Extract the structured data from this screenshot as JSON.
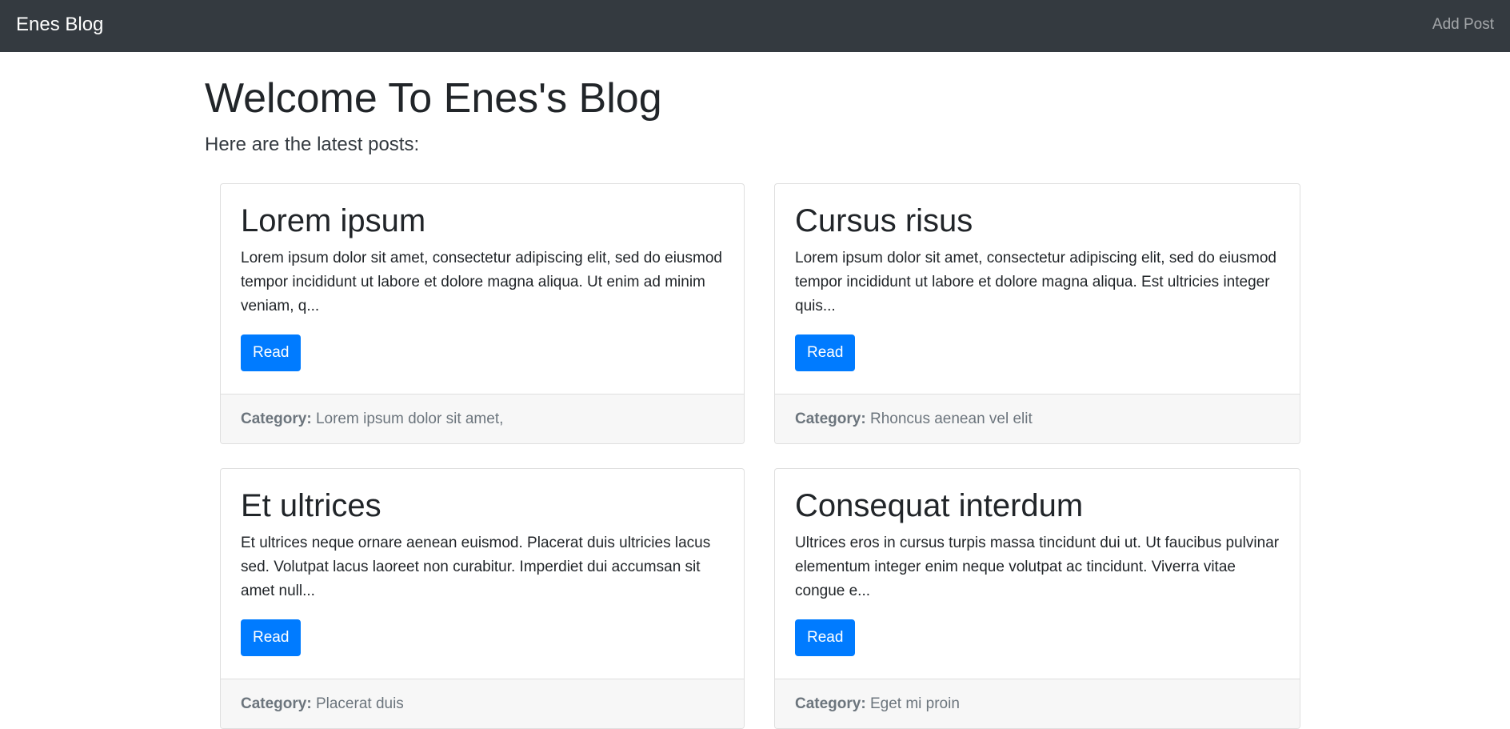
{
  "navbar": {
    "brand": "Enes Blog",
    "add_post": "Add Post"
  },
  "hero": {
    "title": "Welcome To Enes's Blog",
    "subtitle": "Here are the latest posts:"
  },
  "posts": [
    {
      "title": "Lorem ipsum",
      "excerpt": "Lorem ipsum dolor sit amet, consectetur adipiscing elit, sed do eiusmod tempor incididunt ut labore et dolore magna aliqua. Ut enim ad minim veniam, q...",
      "button": "Read",
      "category_label": "Category:",
      "category": "Lorem ipsum dolor sit amet,"
    },
    {
      "title": "Cursus risus",
      "excerpt": "Lorem ipsum dolor sit amet, consectetur adipiscing elit, sed do eiusmod tempor incididunt ut labore et dolore magna aliqua. Est ultricies integer quis...",
      "button": "Read",
      "category_label": "Category:",
      "category": "Rhoncus aenean vel elit"
    },
    {
      "title": "Et ultrices",
      "excerpt": "Et ultrices neque ornare aenean euismod. Placerat duis ultricies lacus sed. Volutpat lacus laoreet non curabitur. Imperdiet dui accumsan sit amet null...",
      "button": "Read",
      "category_label": "Category:",
      "category": "Placerat duis"
    },
    {
      "title": "Consequat interdum",
      "excerpt": "Ultrices eros in cursus turpis massa tincidunt dui ut. Ut faucibus pulvinar elementum integer enim neque volutpat ac tincidunt. Viverra vitae congue e...",
      "button": "Read",
      "category_label": "Category:",
      "category": "Eget mi proin"
    }
  ],
  "colors": {
    "navbar_bg": "#343a40",
    "primary": "#007bff",
    "footer_bg": "#f7f7f7",
    "muted": "#6c757d"
  }
}
